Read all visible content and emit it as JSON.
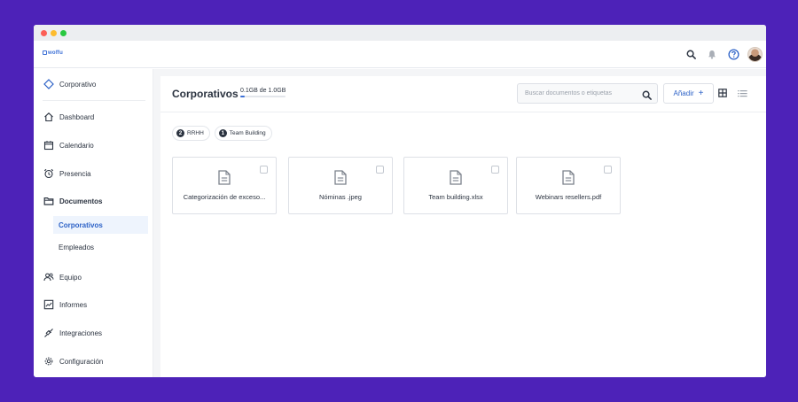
{
  "app": {
    "logo_text": "woffu",
    "accent": "#2d62c7",
    "background": "#4d22b8"
  },
  "topbar": {
    "icons": [
      "search-icon",
      "bell-icon",
      "help-icon",
      "user-avatar"
    ]
  },
  "sidebar": {
    "company": {
      "label": "Corporativo",
      "icon": "diamond-icon"
    },
    "items": [
      {
        "label": "Dashboard",
        "icon": "home-icon"
      },
      {
        "label": "Calendario",
        "icon": "calendar-icon"
      },
      {
        "label": "Presencia",
        "icon": "alarm-clock-icon"
      },
      {
        "label": "Documentos",
        "icon": "folder-icon"
      },
      {
        "label": "Equipo",
        "icon": "team-icon"
      },
      {
        "label": "Informes",
        "icon": "chart-icon"
      },
      {
        "label": "Integraciones",
        "icon": "plug-icon"
      },
      {
        "label": "Configuración",
        "icon": "gear-icon"
      }
    ],
    "sub_items": [
      {
        "label": "Corporativos",
        "active": true
      },
      {
        "label": "Empleados",
        "active": false
      }
    ]
  },
  "main": {
    "title": "Corporativos",
    "quota": "0.1GB de 1.0GB",
    "quota_used_fraction": 0.1,
    "search_placeholder": "Buscar documentos o etiquetas",
    "add_label": "Añadir",
    "add_symbol": "+",
    "tags": [
      {
        "count": "2",
        "label": "RRHH"
      },
      {
        "count": "1",
        "label": "Team Building"
      }
    ],
    "files": [
      {
        "name": "Categorización de exceso..."
      },
      {
        "name": "Nóminas .jpeg"
      },
      {
        "name": "Team building.xlsx"
      },
      {
        "name": "Webinars resellers.pdf"
      }
    ]
  }
}
